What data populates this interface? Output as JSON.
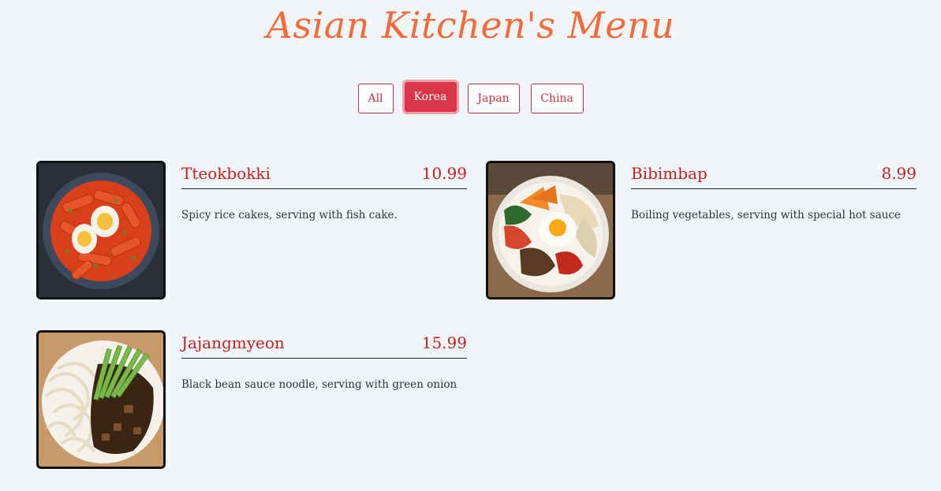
{
  "page": {
    "title": "Asian Kitchen's Menu"
  },
  "filters": [
    {
      "label": "All",
      "active": false
    },
    {
      "label": "Korea",
      "active": true
    },
    {
      "label": "Japan",
      "active": false
    },
    {
      "label": "China",
      "active": false
    }
  ],
  "menu": [
    {
      "name": "Tteokbokki",
      "price": "10.99",
      "description": "Spicy rice cakes, serving with fish cake.",
      "image": "tteokbokki-image"
    },
    {
      "name": "Bibimbap",
      "price": "8.99",
      "description": "Boiling vegetables, serving with special hot sauce",
      "image": "bibimbap-image"
    },
    {
      "name": "Jajangmyeon",
      "price": "15.99",
      "description": "Black bean sauce noodle, serving with green onion",
      "image": "jajangmyeon-image"
    }
  ],
  "colors": {
    "background": "#f1f5f8",
    "title": "#f26b3a",
    "accent": "#c9303d",
    "active_filter": "#d9364a",
    "item_text": "#c1201f"
  }
}
